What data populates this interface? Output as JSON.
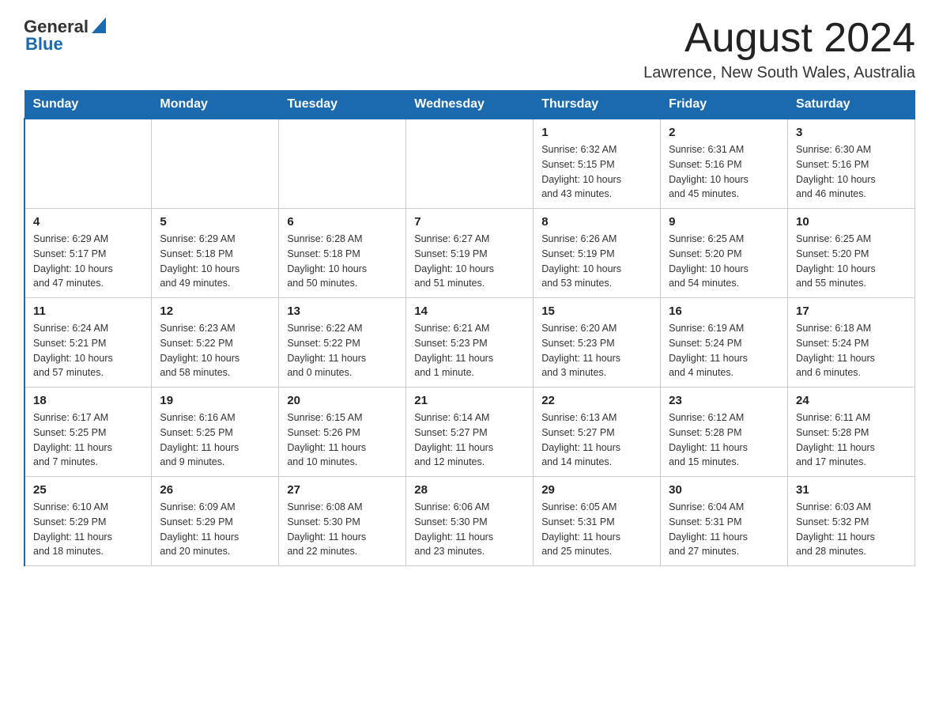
{
  "header": {
    "logo": {
      "general": "General",
      "blue": "Blue"
    },
    "title": "August 2024",
    "location": "Lawrence, New South Wales, Australia"
  },
  "days_of_week": [
    "Sunday",
    "Monday",
    "Tuesday",
    "Wednesday",
    "Thursday",
    "Friday",
    "Saturday"
  ],
  "weeks": [
    [
      {
        "day": "",
        "info": ""
      },
      {
        "day": "",
        "info": ""
      },
      {
        "day": "",
        "info": ""
      },
      {
        "day": "",
        "info": ""
      },
      {
        "day": "1",
        "info": "Sunrise: 6:32 AM\nSunset: 5:15 PM\nDaylight: 10 hours\nand 43 minutes."
      },
      {
        "day": "2",
        "info": "Sunrise: 6:31 AM\nSunset: 5:16 PM\nDaylight: 10 hours\nand 45 minutes."
      },
      {
        "day": "3",
        "info": "Sunrise: 6:30 AM\nSunset: 5:16 PM\nDaylight: 10 hours\nand 46 minutes."
      }
    ],
    [
      {
        "day": "4",
        "info": "Sunrise: 6:29 AM\nSunset: 5:17 PM\nDaylight: 10 hours\nand 47 minutes."
      },
      {
        "day": "5",
        "info": "Sunrise: 6:29 AM\nSunset: 5:18 PM\nDaylight: 10 hours\nand 49 minutes."
      },
      {
        "day": "6",
        "info": "Sunrise: 6:28 AM\nSunset: 5:18 PM\nDaylight: 10 hours\nand 50 minutes."
      },
      {
        "day": "7",
        "info": "Sunrise: 6:27 AM\nSunset: 5:19 PM\nDaylight: 10 hours\nand 51 minutes."
      },
      {
        "day": "8",
        "info": "Sunrise: 6:26 AM\nSunset: 5:19 PM\nDaylight: 10 hours\nand 53 minutes."
      },
      {
        "day": "9",
        "info": "Sunrise: 6:25 AM\nSunset: 5:20 PM\nDaylight: 10 hours\nand 54 minutes."
      },
      {
        "day": "10",
        "info": "Sunrise: 6:25 AM\nSunset: 5:20 PM\nDaylight: 10 hours\nand 55 minutes."
      }
    ],
    [
      {
        "day": "11",
        "info": "Sunrise: 6:24 AM\nSunset: 5:21 PM\nDaylight: 10 hours\nand 57 minutes."
      },
      {
        "day": "12",
        "info": "Sunrise: 6:23 AM\nSunset: 5:22 PM\nDaylight: 10 hours\nand 58 minutes."
      },
      {
        "day": "13",
        "info": "Sunrise: 6:22 AM\nSunset: 5:22 PM\nDaylight: 11 hours\nand 0 minutes."
      },
      {
        "day": "14",
        "info": "Sunrise: 6:21 AM\nSunset: 5:23 PM\nDaylight: 11 hours\nand 1 minute."
      },
      {
        "day": "15",
        "info": "Sunrise: 6:20 AM\nSunset: 5:23 PM\nDaylight: 11 hours\nand 3 minutes."
      },
      {
        "day": "16",
        "info": "Sunrise: 6:19 AM\nSunset: 5:24 PM\nDaylight: 11 hours\nand 4 minutes."
      },
      {
        "day": "17",
        "info": "Sunrise: 6:18 AM\nSunset: 5:24 PM\nDaylight: 11 hours\nand 6 minutes."
      }
    ],
    [
      {
        "day": "18",
        "info": "Sunrise: 6:17 AM\nSunset: 5:25 PM\nDaylight: 11 hours\nand 7 minutes."
      },
      {
        "day": "19",
        "info": "Sunrise: 6:16 AM\nSunset: 5:25 PM\nDaylight: 11 hours\nand 9 minutes."
      },
      {
        "day": "20",
        "info": "Sunrise: 6:15 AM\nSunset: 5:26 PM\nDaylight: 11 hours\nand 10 minutes."
      },
      {
        "day": "21",
        "info": "Sunrise: 6:14 AM\nSunset: 5:27 PM\nDaylight: 11 hours\nand 12 minutes."
      },
      {
        "day": "22",
        "info": "Sunrise: 6:13 AM\nSunset: 5:27 PM\nDaylight: 11 hours\nand 14 minutes."
      },
      {
        "day": "23",
        "info": "Sunrise: 6:12 AM\nSunset: 5:28 PM\nDaylight: 11 hours\nand 15 minutes."
      },
      {
        "day": "24",
        "info": "Sunrise: 6:11 AM\nSunset: 5:28 PM\nDaylight: 11 hours\nand 17 minutes."
      }
    ],
    [
      {
        "day": "25",
        "info": "Sunrise: 6:10 AM\nSunset: 5:29 PM\nDaylight: 11 hours\nand 18 minutes."
      },
      {
        "day": "26",
        "info": "Sunrise: 6:09 AM\nSunset: 5:29 PM\nDaylight: 11 hours\nand 20 minutes."
      },
      {
        "day": "27",
        "info": "Sunrise: 6:08 AM\nSunset: 5:30 PM\nDaylight: 11 hours\nand 22 minutes."
      },
      {
        "day": "28",
        "info": "Sunrise: 6:06 AM\nSunset: 5:30 PM\nDaylight: 11 hours\nand 23 minutes."
      },
      {
        "day": "29",
        "info": "Sunrise: 6:05 AM\nSunset: 5:31 PM\nDaylight: 11 hours\nand 25 minutes."
      },
      {
        "day": "30",
        "info": "Sunrise: 6:04 AM\nSunset: 5:31 PM\nDaylight: 11 hours\nand 27 minutes."
      },
      {
        "day": "31",
        "info": "Sunrise: 6:03 AM\nSunset: 5:32 PM\nDaylight: 11 hours\nand 28 minutes."
      }
    ]
  ]
}
